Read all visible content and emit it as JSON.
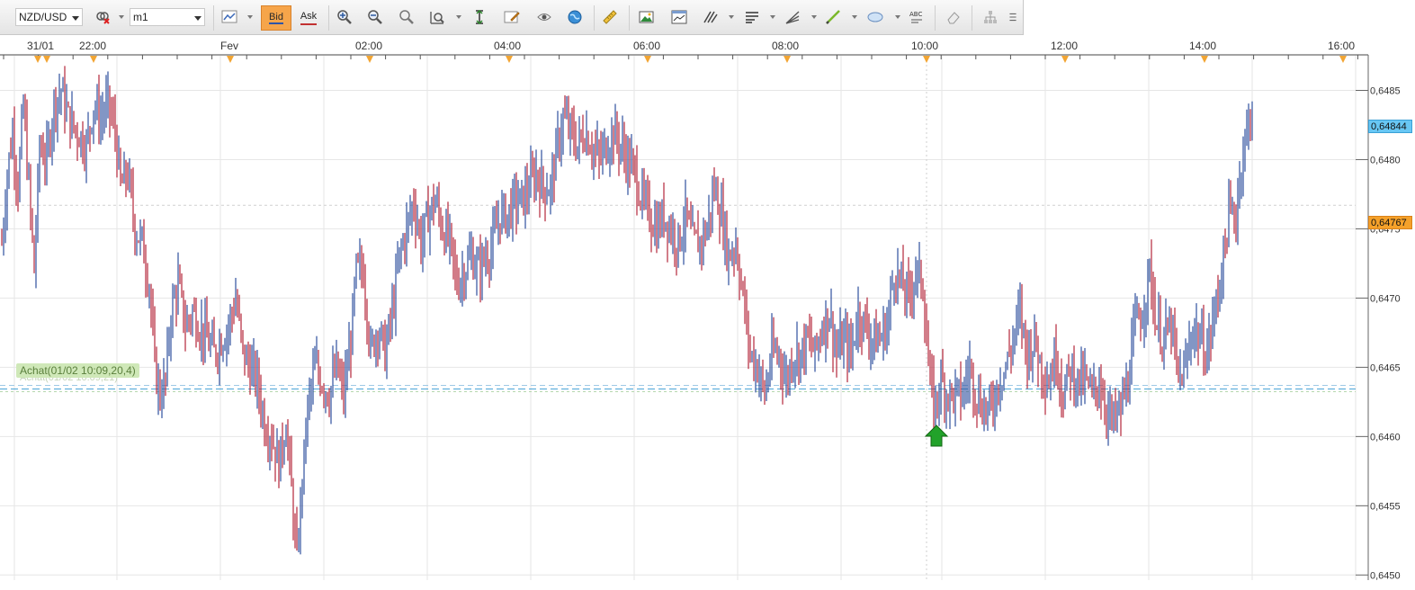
{
  "toolbar": {
    "symbol": "NZD/USD",
    "timeframe": "m1",
    "bid_label": "Bid",
    "ask_label": "Ask"
  },
  "order": {
    "label": "Achat(01/02 10:09,20,4)",
    "ghost_label": "Achat(01/02 10:09,21)",
    "price": 0.64635,
    "color": "#4aa5d8"
  },
  "price_badges": {
    "current": "0,64844",
    "line": "0,64767"
  },
  "colors": {
    "up": "#2f4f9e",
    "down": "#b3263a",
    "current_badge": "#68c7f4",
    "line_badge": "#f5a12a",
    "buy_arrow": "#22a22a",
    "time_marker": "#f2a533"
  },
  "chart_data": {
    "type": "candlestick",
    "symbol": "NZD/USD",
    "timeframe": "m1",
    "x_axis": {
      "ticks": [
        "31/01",
        "22:00",
        "Fev",
        "02:00",
        "04:00",
        "06:00",
        "08:00",
        "10:00",
        "12:00",
        "14:00",
        "16:00"
      ]
    },
    "y_axis": {
      "ticks": [
        "0,6485",
        "0,6480",
        "0,6475",
        "0,6470",
        "0,6465",
        "0,6460",
        "0,6455",
        "0,6450"
      ],
      "tick_values": [
        0.6485,
        0.648,
        0.6475,
        0.647,
        0.6465,
        0.646,
        0.6455,
        0.645
      ],
      "ylim": [
        0.64495,
        0.64875
      ]
    },
    "grid": true,
    "price_path": [
      [
        0,
        0.6474
      ],
      [
        6,
        0.6479
      ],
      [
        12,
        0.6482
      ],
      [
        18,
        0.6478
      ],
      [
        24,
        0.6484
      ],
      [
        30,
        0.6478
      ],
      [
        36,
        0.6472
      ],
      [
        42,
        0.6481
      ],
      [
        50,
        0.648
      ],
      [
        58,
        0.6484
      ],
      [
        66,
        0.6485
      ],
      [
        74,
        0.6483
      ],
      [
        84,
        0.6482
      ],
      [
        94,
        0.6481
      ],
      [
        102,
        0.6484
      ],
      [
        110,
        0.6483
      ],
      [
        118,
        0.6484
      ],
      [
        126,
        0.6482
      ],
      [
        132,
        0.6478
      ],
      [
        140,
        0.6479
      ],
      [
        148,
        0.6475
      ],
      [
        156,
        0.6474
      ],
      [
        164,
        0.6471
      ],
      [
        170,
        0.6465
      ],
      [
        176,
        0.6463
      ],
      [
        182,
        0.6464
      ],
      [
        188,
        0.6469
      ],
      [
        196,
        0.6471
      ],
      [
        204,
        0.6468
      ],
      [
        212,
        0.6469
      ],
      [
        220,
        0.6468
      ],
      [
        228,
        0.6467
      ],
      [
        236,
        0.6466
      ],
      [
        244,
        0.6467
      ],
      [
        252,
        0.6468
      ],
      [
        260,
        0.647
      ],
      [
        268,
        0.6466
      ],
      [
        276,
        0.6465
      ],
      [
        284,
        0.6464
      ],
      [
        292,
        0.6461
      ],
      [
        300,
        0.646
      ],
      [
        308,
        0.6458
      ],
      [
        316,
        0.6461
      ],
      [
        322,
        0.6456
      ],
      [
        328,
        0.6451
      ],
      [
        334,
        0.6457
      ],
      [
        340,
        0.6462
      ],
      [
        348,
        0.6465
      ],
      [
        356,
        0.6464
      ],
      [
        364,
        0.6463
      ],
      [
        372,
        0.6465
      ],
      [
        380,
        0.6463
      ],
      [
        388,
        0.6467
      ],
      [
        394,
        0.6472
      ],
      [
        402,
        0.6472
      ],
      [
        410,
        0.6466
      ],
      [
        418,
        0.6468
      ],
      [
        426,
        0.6466
      ],
      [
        434,
        0.6469
      ],
      [
        442,
        0.6473
      ],
      [
        450,
        0.6475
      ],
      [
        458,
        0.6477
      ],
      [
        466,
        0.6474
      ],
      [
        474,
        0.6476
      ],
      [
        482,
        0.6477
      ],
      [
        490,
        0.6475
      ],
      [
        498,
        0.6474
      ],
      [
        506,
        0.6471
      ],
      [
        514,
        0.6472
      ],
      [
        522,
        0.6473
      ],
      [
        530,
        0.6472
      ],
      [
        538,
        0.6473
      ],
      [
        546,
        0.6474
      ],
      [
        554,
        0.6476
      ],
      [
        562,
        0.6476
      ],
      [
        570,
        0.6477
      ],
      [
        578,
        0.6477
      ],
      [
        586,
        0.6478
      ],
      [
        594,
        0.6479
      ],
      [
        602,
        0.6478
      ],
      [
        610,
        0.6478
      ],
      [
        618,
        0.6481
      ],
      [
        624,
        0.6483
      ],
      [
        632,
        0.6482
      ],
      [
        640,
        0.6481
      ],
      [
        648,
        0.6482
      ],
      [
        656,
        0.6481
      ],
      [
        664,
        0.648
      ],
      [
        672,
        0.6481
      ],
      [
        680,
        0.6482
      ],
      [
        688,
        0.6481
      ],
      [
        696,
        0.648
      ],
      [
        704,
        0.6479
      ],
      [
        712,
        0.6477
      ],
      [
        720,
        0.6476
      ],
      [
        728,
        0.6475
      ],
      [
        736,
        0.6476
      ],
      [
        744,
        0.6475
      ],
      [
        752,
        0.6474
      ],
      [
        760,
        0.6476
      ],
      [
        768,
        0.6474
      ],
      [
        776,
        0.6474
      ],
      [
        784,
        0.6475
      ],
      [
        792,
        0.6478
      ],
      [
        800,
        0.6476
      ],
      [
        808,
        0.6473
      ],
      [
        816,
        0.6474
      ],
      [
        824,
        0.647
      ],
      [
        832,
        0.6466
      ],
      [
        840,
        0.6465
      ],
      [
        848,
        0.6463
      ],
      [
        856,
        0.6466
      ],
      [
        864,
        0.6466
      ],
      [
        872,
        0.6464
      ],
      [
        880,
        0.6466
      ],
      [
        888,
        0.6466
      ],
      [
        896,
        0.6467
      ],
      [
        904,
        0.6466
      ],
      [
        912,
        0.6468
      ],
      [
        920,
        0.6469
      ],
      [
        928,
        0.6466
      ],
      [
        936,
        0.6467
      ],
      [
        944,
        0.6466
      ],
      [
        952,
        0.6469
      ],
      [
        960,
        0.6468
      ],
      [
        968,
        0.6467
      ],
      [
        976,
        0.6467
      ],
      [
        984,
        0.6468
      ],
      [
        992,
        0.6472
      ],
      [
        1000,
        0.6471
      ],
      [
        1008,
        0.647
      ],
      [
        1016,
        0.6472
      ],
      [
        1024,
        0.6471
      ],
      [
        1030,
        0.6465
      ],
      [
        1036,
        0.6462
      ],
      [
        1044,
        0.6464
      ],
      [
        1052,
        0.6463
      ],
      [
        1060,
        0.6463
      ],
      [
        1068,
        0.6463
      ],
      [
        1076,
        0.6465
      ],
      [
        1084,
        0.6463
      ],
      [
        1092,
        0.6462
      ],
      [
        1100,
        0.6462
      ],
      [
        1108,
        0.6464
      ],
      [
        1116,
        0.6465
      ],
      [
        1124,
        0.6467
      ],
      [
        1132,
        0.6469
      ],
      [
        1140,
        0.6466
      ],
      [
        1148,
        0.6467
      ],
      [
        1156,
        0.6465
      ],
      [
        1164,
        0.6464
      ],
      [
        1172,
        0.6466
      ],
      [
        1180,
        0.6463
      ],
      [
        1188,
        0.6465
      ],
      [
        1196,
        0.6464
      ],
      [
        1204,
        0.6464
      ],
      [
        1212,
        0.6463
      ],
      [
        1220,
        0.6464
      ],
      [
        1228,
        0.6462
      ],
      [
        1236,
        0.6461
      ],
      [
        1244,
        0.6462
      ],
      [
        1252,
        0.6464
      ],
      [
        1260,
        0.6468
      ],
      [
        1268,
        0.6469
      ],
      [
        1276,
        0.6472
      ],
      [
        1284,
        0.6468
      ],
      [
        1292,
        0.6467
      ],
      [
        1300,
        0.6468
      ],
      [
        1308,
        0.6464
      ],
      [
        1316,
        0.6465
      ],
      [
        1324,
        0.6468
      ],
      [
        1332,
        0.6467
      ],
      [
        1340,
        0.6466
      ],
      [
        1348,
        0.6469
      ],
      [
        1356,
        0.6472
      ],
      [
        1364,
        0.6476
      ],
      [
        1372,
        0.6476
      ],
      [
        1378,
        0.648
      ],
      [
        1384,
        0.6482
      ],
      [
        1390,
        0.6484
      ]
    ]
  }
}
